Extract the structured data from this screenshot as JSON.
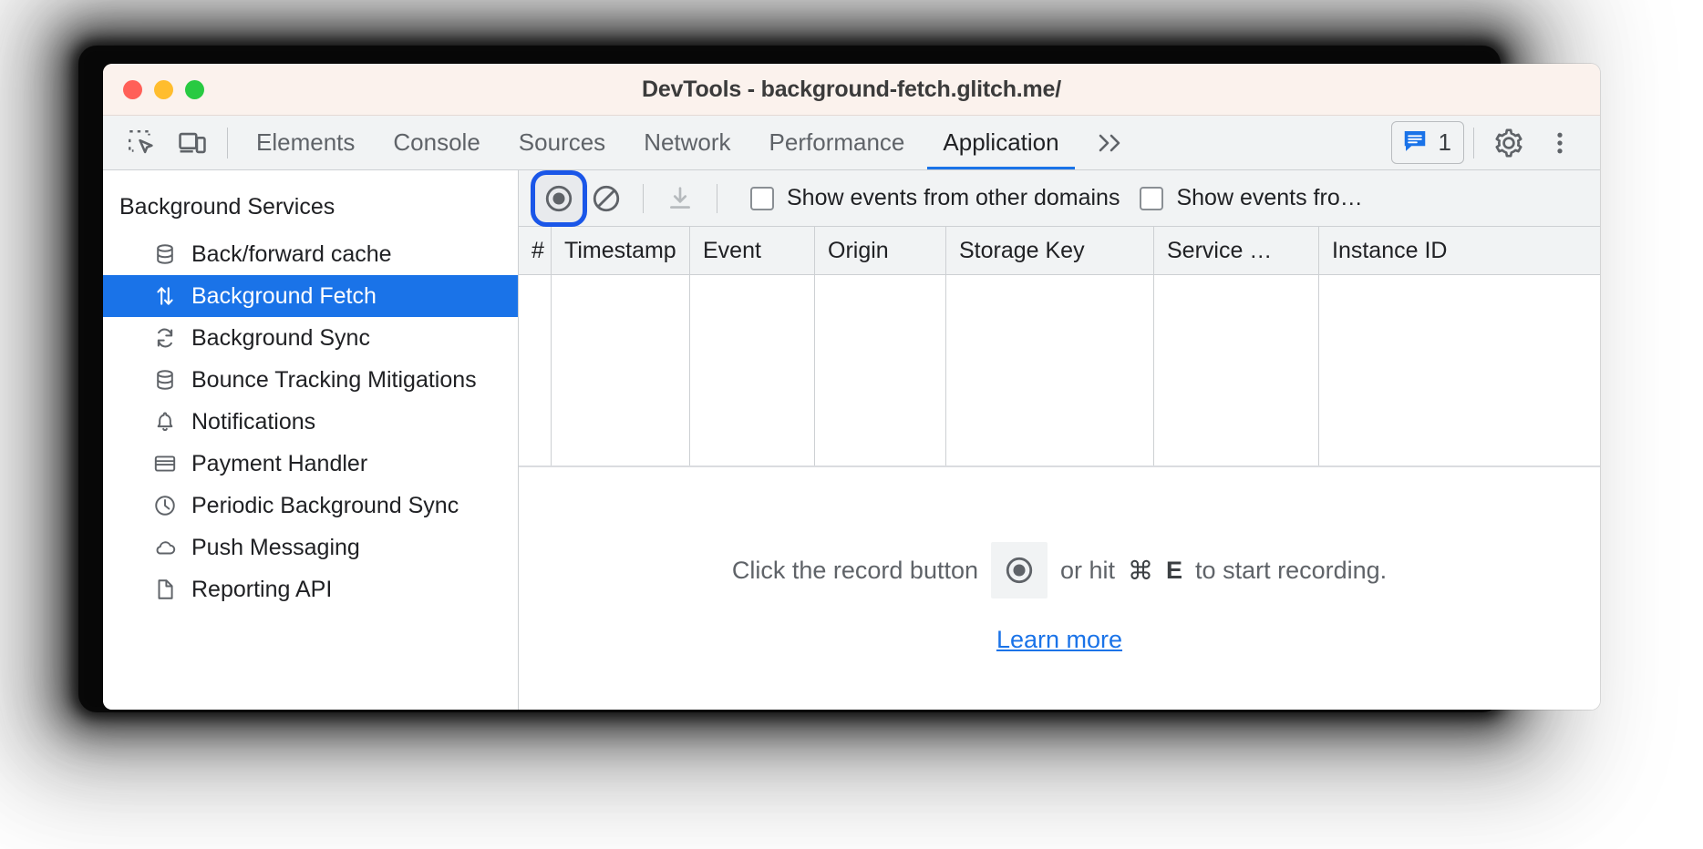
{
  "window": {
    "title": "DevTools - background-fetch.glitch.me/",
    "traffic_lights": [
      "close",
      "minimize",
      "maximize"
    ],
    "colors": {
      "accent_blue": "#1a73e8",
      "focus_ring": "#1a56e8",
      "titlebar_bg": "#fbf2ed",
      "toolbar_bg": "#f1f3f4",
      "selected_row": "#1a73e8"
    }
  },
  "tabbar": {
    "left_icons": [
      {
        "name": "inspect-element-icon",
        "label": "Inspect element"
      },
      {
        "name": "device-toolbar-icon",
        "label": "Toggle device toolbar"
      }
    ],
    "tabs": [
      {
        "label": "Elements",
        "active": false
      },
      {
        "label": "Console",
        "active": false
      },
      {
        "label": "Sources",
        "active": false
      },
      {
        "label": "Network",
        "active": false
      },
      {
        "label": "Performance",
        "active": false
      },
      {
        "label": "Application",
        "active": true
      }
    ],
    "more_tabs_label": "»",
    "issues": {
      "icon": "message-bubble-icon",
      "count": "1"
    },
    "settings_icon": "gear-icon",
    "menu_icon": "kebab-menu-icon"
  },
  "sidebar": {
    "header": "Background Services",
    "items": [
      {
        "label": "Back/forward cache",
        "icon": "database-icon",
        "selected": false
      },
      {
        "label": "Background Fetch",
        "icon": "up-down-arrows-icon",
        "selected": true
      },
      {
        "label": "Background Sync",
        "icon": "sync-arrows-icon",
        "selected": false
      },
      {
        "label": "Bounce Tracking Mitigations",
        "icon": "database-icon",
        "selected": false
      },
      {
        "label": "Notifications",
        "icon": "bell-icon",
        "selected": false
      },
      {
        "label": "Payment Handler",
        "icon": "credit-card-icon",
        "selected": false
      },
      {
        "label": "Periodic Background Sync",
        "icon": "clock-icon",
        "selected": false
      },
      {
        "label": "Push Messaging",
        "icon": "cloud-icon",
        "selected": false
      },
      {
        "label": "Reporting API",
        "icon": "document-icon",
        "selected": false
      }
    ]
  },
  "panel": {
    "toolbar": {
      "record_button": {
        "name": "record-button",
        "focused": true
      },
      "clear_button": {
        "name": "clear-button"
      },
      "download_button": {
        "name": "download-button",
        "disabled": true
      },
      "checkboxes": [
        {
          "label": "Show events from other domains",
          "checked": false
        },
        {
          "label": "Show events fro…",
          "checked": false
        }
      ]
    },
    "table": {
      "columns": [
        "#",
        "Timestamp",
        "Event",
        "Origin",
        "Storage Key",
        "Service …",
        "Instance ID"
      ],
      "rows": []
    },
    "empty_state": {
      "text_before": "Click the record button",
      "text_middle": "or hit",
      "kbd_modifier": "⌘",
      "kbd_key": "E",
      "text_after": "to start recording.",
      "link": "Learn more"
    }
  }
}
